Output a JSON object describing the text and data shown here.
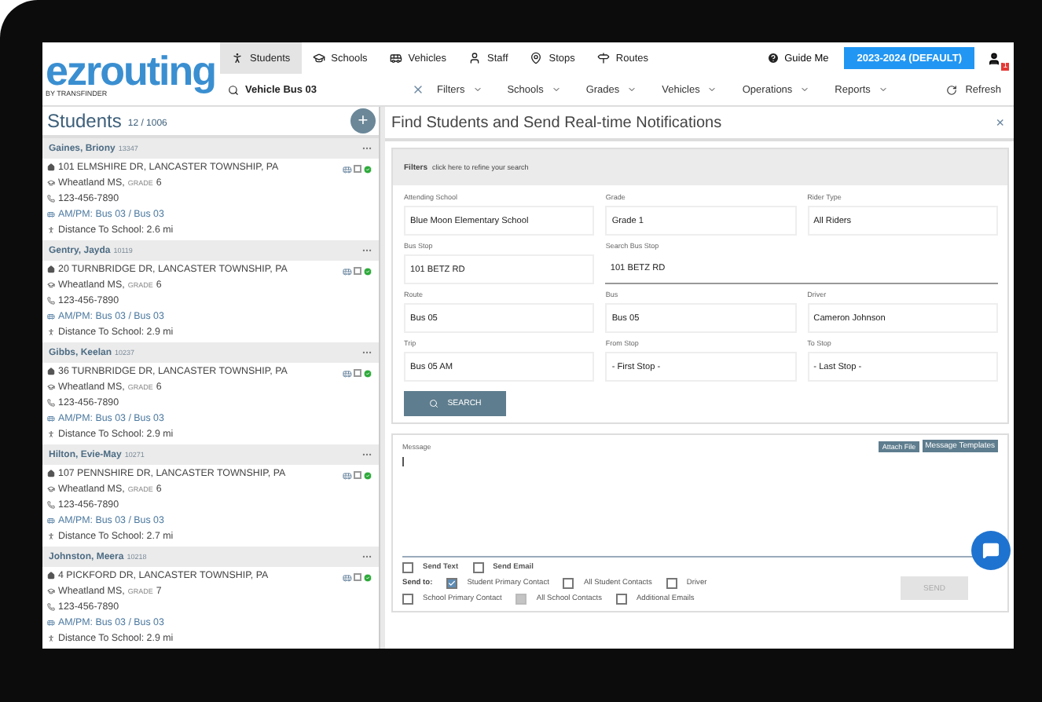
{
  "app": {
    "logo": "ezrouting",
    "logo_sub": "BY TRANSFINDER"
  },
  "nav_tabs": [
    {
      "label": "Students",
      "selected": true
    },
    {
      "label": "Schools",
      "selected": false
    },
    {
      "label": "Vehicles",
      "selected": false
    },
    {
      "label": "Staff",
      "selected": false
    },
    {
      "label": "Stops",
      "selected": false
    },
    {
      "label": "Routes",
      "selected": false
    }
  ],
  "guide": "Guide Me",
  "year_button": "2023-2024 (DEFAULT)",
  "user_badge": "1",
  "search": {
    "value": "Vehicle Bus 03"
  },
  "menus": [
    "Filters",
    "Schools",
    "Grades",
    "Vehicles",
    "Operations",
    "Reports"
  ],
  "refresh": "Refresh",
  "students_panel": {
    "title": "Students",
    "count": "12 / 1006",
    "add": "+",
    "students": [
      {
        "name": "Gaines, Briony",
        "id": "13347",
        "address": "101 ELMSHIRE DR, LANCASTER TOWNSHIP, PA",
        "school": "Wheatland MS,",
        "grade_label": "GRADE",
        "grade": "6",
        "phone": "123-456-7890",
        "bus": "AM/PM: Bus 03 / Bus 03",
        "distance": "Distance To School: 2.6 mi"
      },
      {
        "name": "Gentry, Jayda",
        "id": "10119",
        "address": "20 TURNBRIDGE DR, LANCASTER TOWNSHIP, PA",
        "school": "Wheatland MS,",
        "grade_label": "GRADE",
        "grade": "6",
        "phone": "123-456-7890",
        "bus": "AM/PM: Bus 03 / Bus 03",
        "distance": "Distance To School: 2.9 mi"
      },
      {
        "name": "Gibbs, Keelan",
        "id": "10237",
        "address": "36 TURNBRIDGE DR, LANCASTER TOWNSHIP, PA",
        "school": "Wheatland MS,",
        "grade_label": "GRADE",
        "grade": "6",
        "phone": "123-456-7890",
        "bus": "AM/PM: Bus 03 / Bus 03",
        "distance": "Distance To School: 2.9 mi"
      },
      {
        "name": "Hilton, Evie-May",
        "id": "10271",
        "address": "107 PENNSHIRE DR, LANCASTER TOWNSHIP, PA",
        "school": "Wheatland MS,",
        "grade_label": "GRADE",
        "grade": "6",
        "phone": "123-456-7890",
        "bus": "AM/PM: Bus 03 / Bus 03",
        "distance": "Distance To School: 2.7 mi"
      },
      {
        "name": "Johnston, Meera",
        "id": "10218",
        "address": "4 PICKFORD DR, LANCASTER TOWNSHIP, PA",
        "school": "Wheatland MS,",
        "grade_label": "GRADE",
        "grade": "7",
        "phone": "123-456-7890",
        "bus": "AM/PM: Bus 03 / Bus 03",
        "distance": "Distance To School: 2.9 mi"
      }
    ]
  },
  "notify": {
    "title": "Find Students and Send Real-time Notifications",
    "close": "×",
    "filters_title": "Filters",
    "filters_hint": "click here to refine your search",
    "fields": [
      {
        "label": "Attending School",
        "value": "Blue Moon Elementary School",
        "kind": "box"
      },
      {
        "label": "Grade",
        "value": "Grade 1",
        "kind": "box"
      },
      {
        "label": "Rider Type",
        "value": "All Riders",
        "kind": "box"
      },
      {
        "label": "Bus Stop",
        "value": "101 BETZ RD",
        "kind": "box"
      },
      {
        "label": "Search Bus Stop",
        "value": "101 BETZ RD",
        "kind": "line"
      },
      {
        "label": "Route",
        "value": "Bus 05",
        "kind": "box"
      },
      {
        "label": "Bus",
        "value": "Bus 05",
        "kind": "box"
      },
      {
        "label": "Driver",
        "value": "Cameron Johnson",
        "kind": "box"
      },
      {
        "label": "Trip",
        "value": "Bus 05 AM",
        "kind": "box"
      },
      {
        "label": "From Stop",
        "value": "- First Stop -",
        "kind": "box"
      },
      {
        "label": "To Stop",
        "value": "- Last Stop -",
        "kind": "box"
      }
    ],
    "search_button": "SEARCH",
    "message_label": "Message",
    "attach": "Attach File",
    "templates": "Message Templates",
    "send_options": [
      {
        "label": "Send Text",
        "checked": false
      },
      {
        "label": "Send Email",
        "checked": false
      }
    ],
    "send_to_label": "Send to:",
    "recipients": [
      {
        "label": "Student Primary Contact",
        "checked": true,
        "disabled": false
      },
      {
        "label": "All Student Contacts",
        "checked": false,
        "disabled": false
      },
      {
        "label": "Driver",
        "checked": false,
        "disabled": false
      },
      {
        "label": "School Primary Contact",
        "checked": false,
        "disabled": false
      },
      {
        "label": "All School Contacts",
        "checked": false,
        "disabled": true
      },
      {
        "label": "Additional Emails",
        "checked": false,
        "disabled": false
      }
    ],
    "send_button": "SEND"
  }
}
